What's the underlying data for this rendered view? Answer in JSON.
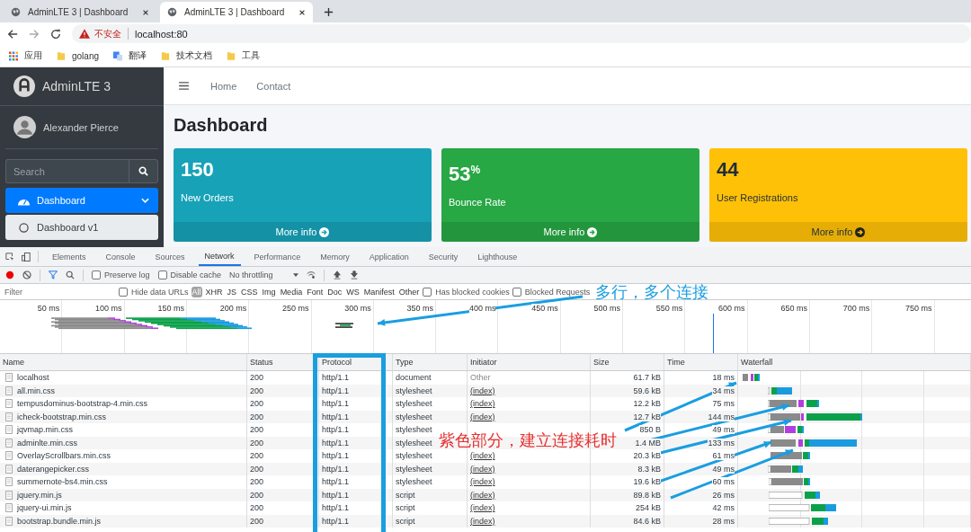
{
  "browser": {
    "tabs": [
      {
        "title": "AdminLTE 3 | Dashboard",
        "selected": false
      },
      {
        "title": "AdminLTE 3 | Dashboard",
        "selected": true
      }
    ],
    "address": {
      "warning": "不安全",
      "url": "localhost:80"
    },
    "bookmarks": [
      {
        "label": "应用",
        "kind": "apps"
      },
      {
        "label": "golang",
        "kind": "folder"
      },
      {
        "label": "翻译",
        "kind": "translate"
      },
      {
        "label": "技术文档",
        "kind": "folder"
      },
      {
        "label": "工具",
        "kind": "folder"
      }
    ]
  },
  "admin": {
    "brand": "AdminLTE 3",
    "user": "Alexander Pierce",
    "search_placeholder": "Search",
    "nav": [
      {
        "label": "Dashboard",
        "kind": "group",
        "selected": true
      },
      {
        "label": "Dashboard v1",
        "kind": "item",
        "selected": false
      }
    ],
    "navbar_links": [
      "Home",
      "Contact"
    ],
    "heading": "Dashboard",
    "cards": [
      {
        "value": "150",
        "label": "New Orders",
        "footer": "More info",
        "color": "#17a2b8"
      },
      {
        "value": "53$^{%}$",
        "label": "Bounce Rate",
        "footer": "More info",
        "color": "#28a745"
      },
      {
        "value": "44",
        "label": "User Registrations",
        "footer": "More info",
        "color": "#ffc107"
      }
    ]
  },
  "devtools": {
    "tabs": [
      {
        "label": "Elements",
        "selected": false
      },
      {
        "label": "Console",
        "selected": false
      },
      {
        "label": "Sources",
        "selected": false
      },
      {
        "label": "Network",
        "selected": true
      },
      {
        "label": "Performance",
        "selected": false
      },
      {
        "label": "Memory",
        "selected": false
      },
      {
        "label": "Application",
        "selected": false
      },
      {
        "label": "Security",
        "selected": false
      },
      {
        "label": "Lighthouse",
        "selected": false
      }
    ],
    "toolbar_checkboxes": [
      {
        "label": "Preserve log",
        "checked": false
      },
      {
        "label": "Disable cache",
        "checked": false
      }
    ],
    "throttling": "No throttling",
    "filter_placeholder": "Filter",
    "hide_data_urls": {
      "label": "Hide data URLs",
      "checked": false
    },
    "types": [
      {
        "label": "All",
        "selected": true
      },
      {
        "label": "XHR",
        "selected": false
      },
      {
        "label": "JS",
        "selected": false
      },
      {
        "label": "CSS",
        "selected": false
      },
      {
        "label": "Img",
        "selected": false
      },
      {
        "label": "Media",
        "selected": false
      },
      {
        "label": "Font",
        "selected": false
      },
      {
        "label": "Doc",
        "selected": false
      },
      {
        "label": "WS",
        "selected": false
      },
      {
        "label": "Manifest",
        "selected": false
      },
      {
        "label": "Other",
        "selected": false
      }
    ],
    "extra_checkboxes": [
      {
        "label": "Has blocked cookies",
        "checked": false
      },
      {
        "label": "Blocked Requests",
        "checked": false
      }
    ],
    "timeline_ticks": [
      "50 ms",
      "100 ms",
      "150 ms",
      "200 ms",
      "250 ms",
      "300 ms",
      "350 ms",
      "400 ms",
      "450 ms",
      "500 ms",
      "550 ms",
      "600 ms",
      "650 ms",
      "700 ms",
      "750 ms"
    ],
    "table": {
      "columns": [
        "Name",
        "Status",
        "Protocol",
        "Type",
        "Initiator",
        "Size",
        "Time",
        "Waterfall"
      ],
      "rows": [
        {
          "name": "localhost",
          "status": "200",
          "protocol": "http/1.1",
          "type": "document",
          "initiator": "Other",
          "initiator_link": false,
          "size": "61.7 kB",
          "time": "18 ms"
        },
        {
          "name": "all.min.css",
          "status": "200",
          "protocol": "http/1.1",
          "type": "stylesheet",
          "initiator": "(index)",
          "initiator_link": true,
          "size": "59.6 kB",
          "time": "34 ms"
        },
        {
          "name": "tempusdominus-bootstrap-4.min.css",
          "status": "200",
          "protocol": "http/1.1",
          "type": "stylesheet",
          "initiator": "(index)",
          "initiator_link": true,
          "size": "12.2 kB",
          "time": "75 ms"
        },
        {
          "name": "icheck-bootstrap.min.css",
          "status": "200",
          "protocol": "http/1.1",
          "type": "stylesheet",
          "initiator": "(index)",
          "initiator_link": true,
          "size": "12.7 kB",
          "time": "144 ms"
        },
        {
          "name": "jqvmap.min.css",
          "status": "200",
          "protocol": "http/1.1",
          "type": "stylesheet",
          "size": "850 B",
          "time": "49 ms"
        },
        {
          "name": "adminlte.min.css",
          "status": "200",
          "protocol": "http/1.1",
          "type": "stylesheet",
          "size": "1.4 MB",
          "time": "133 ms"
        },
        {
          "name": "OverlayScrollbars.min.css",
          "status": "200",
          "protocol": "http/1.1",
          "type": "stylesheet",
          "initiator": "(index)",
          "initiator_link": true,
          "size": "20.3 kB",
          "time": "61 ms"
        },
        {
          "name": "daterangepicker.css",
          "status": "200",
          "protocol": "http/1.1",
          "type": "stylesheet",
          "initiator": "(index)",
          "initiator_link": true,
          "size": "8.3 kB",
          "time": "49 ms"
        },
        {
          "name": "summernote-bs4.min.css",
          "status": "200",
          "protocol": "http/1.1",
          "type": "stylesheet",
          "initiator": "(index)",
          "initiator_link": true,
          "size": "19.6 kB",
          "time": "60 ms"
        },
        {
          "name": "jquery.min.js",
          "status": "200",
          "protocol": "http/1.1",
          "type": "script",
          "initiator": "(index)",
          "initiator_link": true,
          "size": "89.8 kB",
          "time": "26 ms"
        },
        {
          "name": "jquery-ui.min.js",
          "status": "200",
          "protocol": "http/1.1",
          "type": "script",
          "initiator": "(index)",
          "initiator_link": true,
          "size": "254 kB",
          "time": "42 ms"
        },
        {
          "name": "bootstrap.bundle.min.js",
          "status": "200",
          "protocol": "http/1.1",
          "type": "script",
          "initiator": "(index)",
          "initiator_link": true,
          "size": "84.6 kB",
          "time": "28 ms"
        }
      ]
    }
  },
  "annotations": {
    "top": "多行，多个连接",
    "bottom": "紫色部分，建立连接耗时"
  }
}
